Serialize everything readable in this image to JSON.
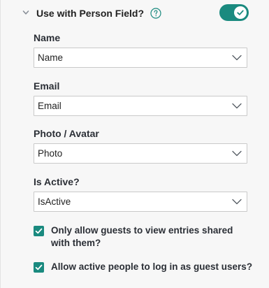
{
  "section": {
    "title": "Use with Person Field?",
    "toggle_on": true,
    "accent_color": "#1a8a7f"
  },
  "fields": [
    {
      "label": "Name",
      "value": "Name"
    },
    {
      "label": "Email",
      "value": "Email"
    },
    {
      "label": "Photo / Avatar",
      "value": "Photo"
    },
    {
      "label": "Is Active?",
      "value": "IsActive"
    }
  ],
  "options": [
    {
      "label": "Only allow guests to view entries shared with them?",
      "checked": true
    },
    {
      "label": "Allow active people to log in as guest users?",
      "checked": true
    }
  ],
  "icons": {
    "collapse": "chevron-down-icon",
    "help": "question-circle-icon",
    "toggle": "check-icon",
    "dropdown": "chevron-down-icon",
    "checkbox": "check-icon"
  }
}
